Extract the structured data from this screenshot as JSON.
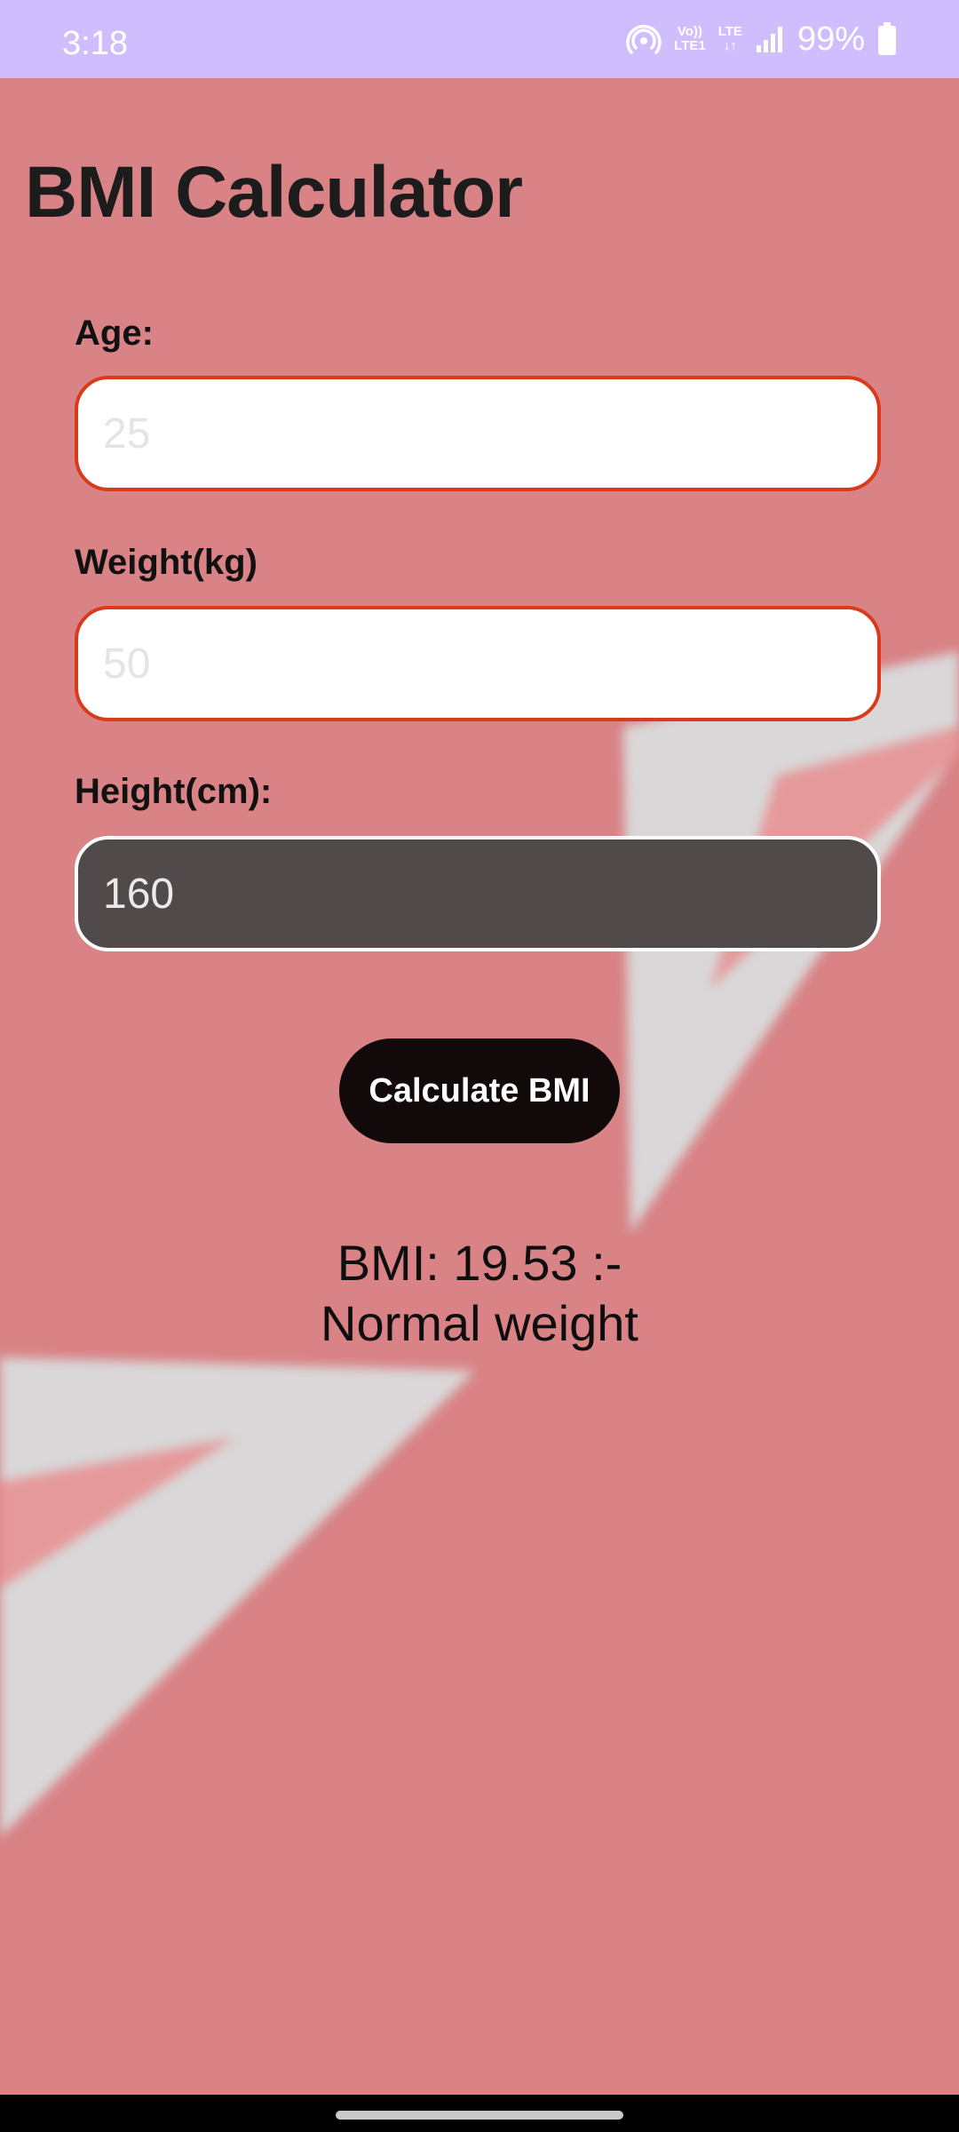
{
  "status_bar": {
    "time": "3:18",
    "volte_top": "Vo))",
    "volte_bottom": "LTE1",
    "lte_top": "LTE",
    "lte_bottom": "↓↑",
    "battery_percent": "99%",
    "icons": [
      "hotspot-icon",
      "volte-icon",
      "lte-icon",
      "signal-icon",
      "battery-icon"
    ],
    "color": "#cfbdfe"
  },
  "app": {
    "title": "BMI Calculator",
    "background_color": "#d98386",
    "fields": [
      {
        "label": "Age:",
        "placeholder": "25",
        "value": ""
      },
      {
        "label": "Weight(kg)",
        "placeholder": "50",
        "value": ""
      },
      {
        "label": "Height(cm):",
        "placeholder": "",
        "value": "160"
      }
    ],
    "calculate_label": "Calculate BMI",
    "result_line1": "BMI: 19.53 :-",
    "result_line2": "Normal weight",
    "accent_error": "#d93a1c",
    "button_color": "#120a0a"
  }
}
